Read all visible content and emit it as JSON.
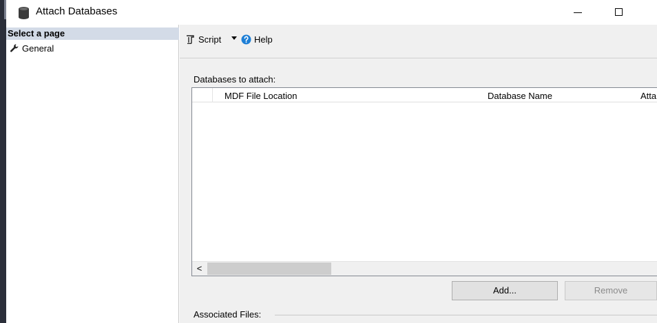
{
  "window": {
    "title": "Attach Databases",
    "title_icon": "database-icon",
    "controls": [
      "minimize",
      "maximize"
    ]
  },
  "sidebar": {
    "header": "Select a page",
    "items": [
      {
        "label": "General",
        "icon": "wrench-icon"
      }
    ]
  },
  "toolbar": {
    "script_label": "Script",
    "script_icon": "script-icon",
    "help_label": "Help",
    "help_icon": "help-icon"
  },
  "main": {
    "databases_label": "Databases to attach:",
    "grid": {
      "columns": [
        "MDF File Location",
        "Database Name",
        "Atta"
      ],
      "rows": []
    },
    "scroll_left_glyph": "<",
    "add_button": "Add...",
    "remove_button": "Remove",
    "associated_files_label": "Associated Files:"
  },
  "colors": {
    "sidebar_header_bg": "#d3dbe7",
    "panel_bg": "#f0f0f0",
    "help_icon": "#1e7fd6"
  }
}
